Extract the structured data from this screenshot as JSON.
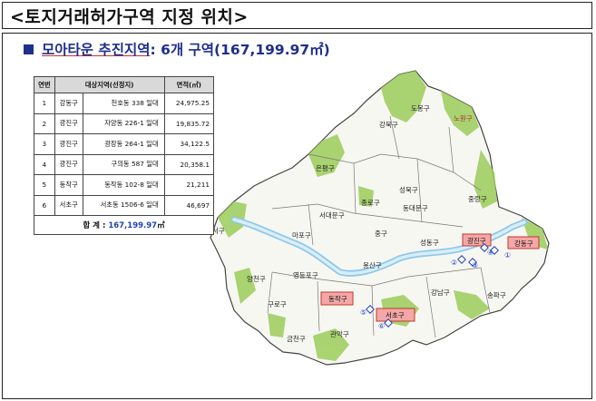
{
  "header": {
    "title": "<토지거래허가구역 지정 위치>"
  },
  "subtitle": {
    "prefix": "모아타운 추진지역",
    "suffix": " : 6개 구역(167,199.97㎡)"
  },
  "table": {
    "headers": [
      "연번",
      "대상지역(선정지)",
      "면적(㎡)"
    ],
    "rows": [
      {
        "no": "1",
        "gu": "강동구",
        "loc": "천호동 338 일대",
        "area": "24,975.25"
      },
      {
        "no": "2",
        "gu": "광진구",
        "loc": "자양동 226-1 일대",
        "area": "19,835.72"
      },
      {
        "no": "3",
        "gu": "광진구",
        "loc": "광장동 264-1 일대",
        "area": "34,122.5"
      },
      {
        "no": "4",
        "gu": "광진구",
        "loc": "구의동 587 일대",
        "area": "20,358.1"
      },
      {
        "no": "5",
        "gu": "동작구",
        "loc": "동작동 102-8 일대",
        "area": "21,211"
      },
      {
        "no": "6",
        "gu": "서초구",
        "loc": "서초동 1506-6 일대",
        "area": "46,697"
      }
    ],
    "total_label": "합  계 : ",
    "total_value": "167,199.97",
    "total_unit": "㎡"
  },
  "map": {
    "districts": [
      "도봉구",
      "노원구",
      "강북구",
      "은평구",
      "성북구",
      "중랑구",
      "종로구",
      "서대문구",
      "동대문구",
      "마포구",
      "중구",
      "강서구",
      "성동구",
      "용산구",
      "양천구",
      "영등포구",
      "구로구",
      "강남구",
      "송파구",
      "금천구",
      "관악구"
    ],
    "highlighted": [
      "광진구",
      "강동구",
      "동작구",
      "서초구"
    ],
    "markers": [
      "①",
      "②",
      "③",
      "④",
      "⑤",
      "⑥"
    ]
  },
  "colors": {
    "accent": "#1f2f8c",
    "highlight_fill": "#f4a7a7",
    "highlight_stroke": "#c0392b",
    "green": "#8cc63f",
    "river": "#c7e3f5"
  }
}
